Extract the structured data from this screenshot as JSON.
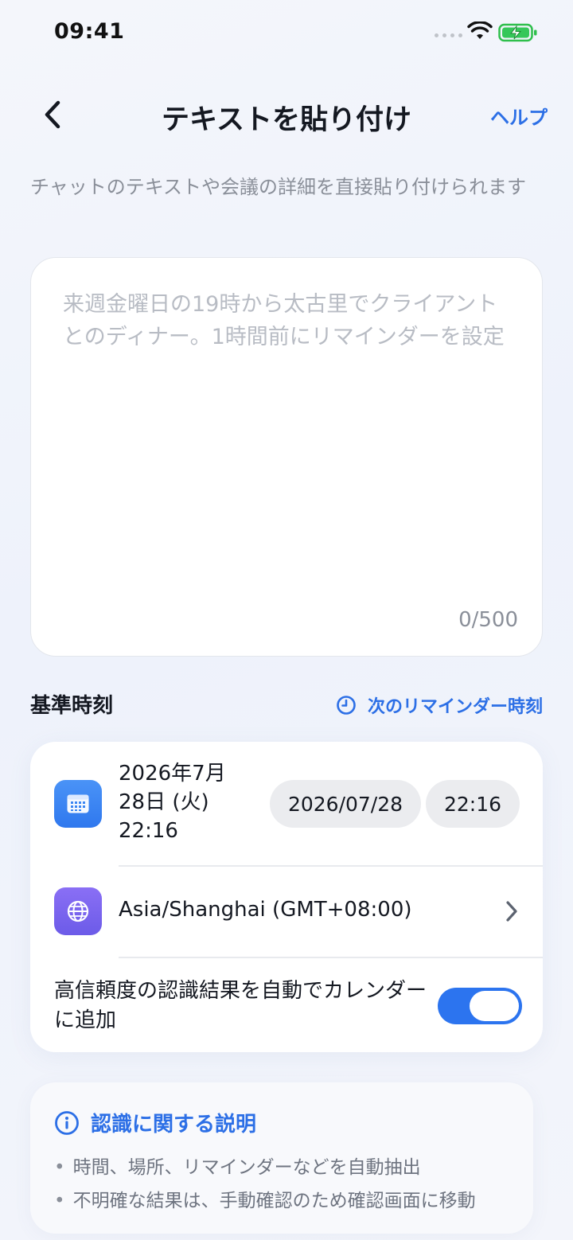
{
  "status_bar": {
    "time": "09:41"
  },
  "nav": {
    "title": "テキストを貼り付け",
    "help_label": "ヘルプ",
    "back_icon": "chevron-left-icon"
  },
  "subtitle": "チャットのテキストや会議の詳細を直接貼り付けられます",
  "text_input": {
    "value": "",
    "placeholder": "来週金曜日の19時から太古里でクライアントとのディナー。1時間前にリマインダーを設定",
    "char_count": "0/500"
  },
  "reference_time": {
    "section_title": "基準時刻",
    "next_reminder_label": "次のリマインダー時刻",
    "datetime_line1": "2026年7月",
    "datetime_line2": "28日 (火)",
    "datetime_line3": "22:16",
    "date_value": "2026/07/28",
    "time_value": "22:16",
    "timezone": "Asia/Shanghai (GMT+08:00)",
    "auto_add_label": "高信頼度の認識結果を自動でカレンダーに追加",
    "auto_add_enabled": true
  },
  "info": {
    "title": "認識に関する説明",
    "items": [
      "時間、場所、リマインダーなどを自動抽出",
      "不明確な結果は、手動確認のため確認画面に移動"
    ]
  },
  "colors": {
    "accent": "#2c6fe6",
    "toggle_on": "#2c74ef",
    "calendar_icon_bg": "#3b86f3",
    "globe_icon_bg": "#7b66ef"
  }
}
